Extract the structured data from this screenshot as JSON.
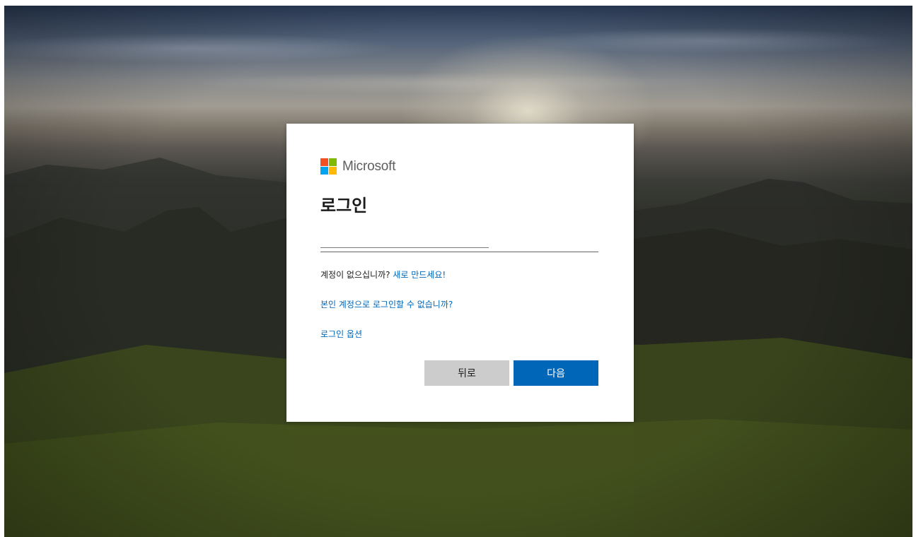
{
  "colors": {
    "accent": "#0067b8",
    "back_button": "#cccccc",
    "logo_red": "#f25022",
    "logo_green": "#7fba00",
    "logo_blue": "#00a4ef",
    "logo_yellow": "#ffb900"
  },
  "signin": {
    "brand": "Microsoft",
    "title": "로그인",
    "email_value": "",
    "no_account_text": "계정이 없으십니까?",
    "create_link": "새로 만드세요!",
    "cant_access_link": "본인 계정으로 로그인할 수 없습니까?",
    "signin_options_link": "로그인 옵션",
    "back_label": "뒤로",
    "next_label": "다음"
  }
}
